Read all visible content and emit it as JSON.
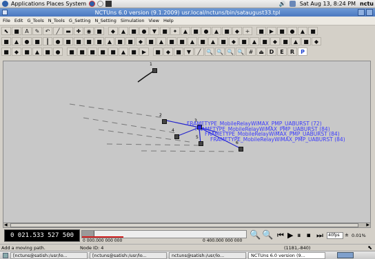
{
  "topbar": {
    "menu": "Applications  Places  System",
    "datetime": "Sat Aug 13,  8:24 PM",
    "user": "nctu"
  },
  "window": {
    "title": "NCTUns 6.0 version (9.1.2009) usr.local/nctuns/bin/sataugust33.tpl"
  },
  "menubar": [
    "File",
    "Edit",
    "G_Tools",
    "N_Tools",
    "G_Setting",
    "N_Setting",
    "Simulation",
    "View",
    "Help"
  ],
  "toolbar_letters": [
    "D",
    "E",
    "R",
    "P"
  ],
  "canvas": {
    "node_labels": [
      "1",
      "2",
      "3",
      "4",
      "5",
      "6"
    ],
    "packets": [
      "FRAMETYPE_MobileRelayWiMAX_PMP_UABURST (72)",
      "FRAMETYPE_MobileRelayWiMAX_PMP_UABURST (84)",
      "FRAMETYPE_MobileRelayWiMAX_PMP_UABURST (84)",
      "FRAMETYPE_MobileRelayWiMAX_PMP_UABURST (84)"
    ]
  },
  "playbar": {
    "clock": "0 021.533 527 500",
    "time_start": "0 000.000 000 000",
    "time_end": "0 400.000 000 000",
    "fps": "40fps",
    "percent": "0.01%"
  },
  "statusbar": {
    "message": "Add a moving path.",
    "node_id": "Node ID: 4",
    "coords": "(1181,-840)"
  },
  "taskbar": {
    "items": [
      "[nctuns@satish:/usr/lo...",
      "[nctuns@satish:/usr/lo...",
      "nctuns@satish:/usr/lo...",
      "NCTUns 6.0 version (9..."
    ]
  },
  "colors": {
    "accent": "#4a78bf",
    "packet_text": "#3a3aff"
  }
}
